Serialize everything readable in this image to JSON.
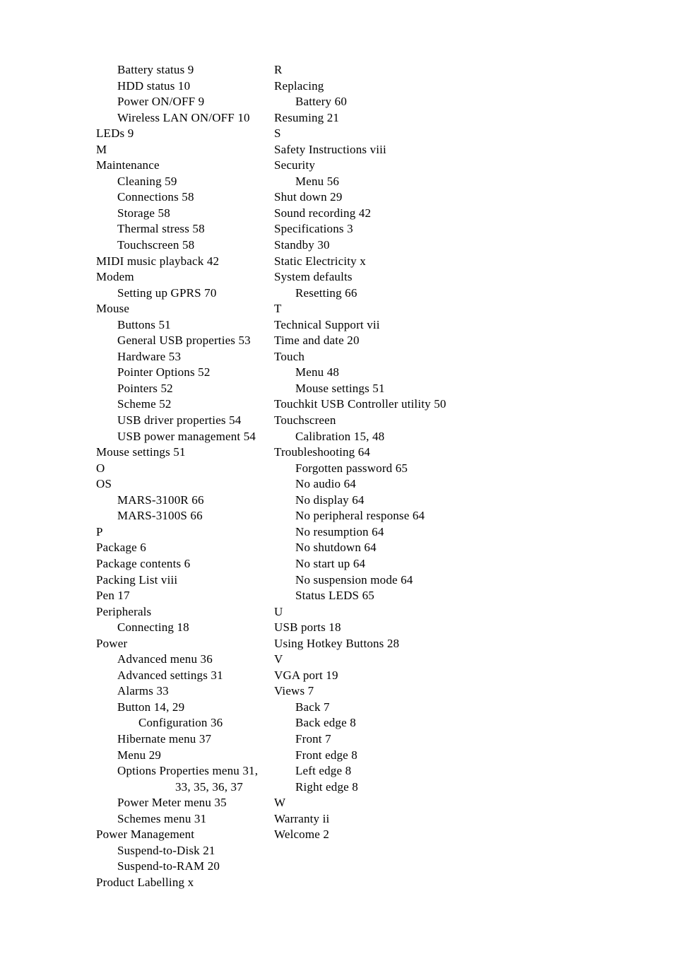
{
  "document": {
    "type": "book-index",
    "page_background": "#ffffff",
    "text_color": "#000000"
  },
  "index": {
    "columns": [
      {
        "name": "left-column",
        "entries": [
          {
            "text": "Battery status 9",
            "level": 1
          },
          {
            "text": "HDD status 10",
            "level": 1
          },
          {
            "text": "Power ON/OFF 9",
            "level": 1
          },
          {
            "text": "Wireless LAN ON/OFF 10",
            "level": 1
          },
          {
            "text": "LEDs 9",
            "level": 0
          },
          {
            "text": "M",
            "level": 0
          },
          {
            "text": "Maintenance",
            "level": 0
          },
          {
            "text": "Cleaning 59",
            "level": 1
          },
          {
            "text": "Connections 58",
            "level": 1
          },
          {
            "text": "Storage 58",
            "level": 1
          },
          {
            "text": "Thermal stress 58",
            "level": 1
          },
          {
            "text": "Touchscreen 58",
            "level": 1
          },
          {
            "text": "MIDI music playback 42",
            "level": 0
          },
          {
            "text": "Modem",
            "level": 0
          },
          {
            "text": "Setting up GPRS 70",
            "level": 1
          },
          {
            "text": "Mouse",
            "level": 0
          },
          {
            "text": "Buttons 51",
            "level": 1
          },
          {
            "text": "General USB properties 53",
            "level": 1
          },
          {
            "text": "Hardware 53",
            "level": 1
          },
          {
            "text": "Pointer Options 52",
            "level": 1
          },
          {
            "text": "Pointers 52",
            "level": 1
          },
          {
            "text": "Scheme 52",
            "level": 1
          },
          {
            "text": "USB driver properties 54",
            "level": 1
          },
          {
            "text": "USB power management 54",
            "level": 1
          },
          {
            "text": "Mouse settings 51",
            "level": 0
          },
          {
            "text": "O",
            "level": 0
          },
          {
            "text": "OS",
            "level": 0
          },
          {
            "text": "MARS-3100R 66",
            "level": 1
          },
          {
            "text": "MARS-3100S 66",
            "level": 1
          },
          {
            "text": "P",
            "level": 0
          },
          {
            "text": "Package 6",
            "level": 0
          },
          {
            "text": "Package contents 6",
            "level": 0
          },
          {
            "text": "Packing List viii",
            "level": 0
          },
          {
            "text": "Pen 17",
            "level": 0
          },
          {
            "text": "Peripherals",
            "level": 0
          },
          {
            "text": "Connecting 18",
            "level": 1
          },
          {
            "text": "Power",
            "level": 0
          },
          {
            "text": "Advanced menu 36",
            "level": 1
          },
          {
            "text": "Advanced settings 31",
            "level": 1
          },
          {
            "text": "Alarms 33",
            "level": 1
          },
          {
            "text": "Button 14, 29",
            "level": 1
          },
          {
            "text": "Configuration 36",
            "level": 2
          },
          {
            "text": "Hibernate menu 37",
            "level": 1
          },
          {
            "text": "Menu 29",
            "level": 1
          },
          {
            "text": "Options Properties menu 31, 33, 35, 36, 37",
            "level": 1,
            "wrap": true
          },
          {
            "text": "Power Meter menu 35",
            "level": 1
          },
          {
            "text": "Schemes menu 31",
            "level": 1
          },
          {
            "text": "Power Management",
            "level": 0
          },
          {
            "text": "Suspend-to-Disk 21",
            "level": 1
          },
          {
            "text": "Suspend-to-RAM 20",
            "level": 1
          },
          {
            "text": "Product Labelling x",
            "level": 0
          }
        ]
      },
      {
        "name": "right-column",
        "entries": [
          {
            "text": "R",
            "level": 0
          },
          {
            "text": "Replacing",
            "level": 0
          },
          {
            "text": "Battery 60",
            "level": 1
          },
          {
            "text": "Resuming 21",
            "level": 0
          },
          {
            "text": "S",
            "level": 0
          },
          {
            "text": "Safety Instructions viii",
            "level": 0
          },
          {
            "text": "Security",
            "level": 0
          },
          {
            "text": "Menu 56",
            "level": 1
          },
          {
            "text": "Shut down 29",
            "level": 0
          },
          {
            "text": "Sound recording 42",
            "level": 0
          },
          {
            "text": "Specifications 3",
            "level": 0
          },
          {
            "text": "Standby 30",
            "level": 0
          },
          {
            "text": "Static Electricity x",
            "level": 0
          },
          {
            "text": "System defaults",
            "level": 0
          },
          {
            "text": "Resetting 66",
            "level": 1
          },
          {
            "text": "T",
            "level": 0
          },
          {
            "text": "Technical Support vii",
            "level": 0
          },
          {
            "text": "Time and date 20",
            "level": 0
          },
          {
            "text": "Touch",
            "level": 0
          },
          {
            "text": "Menu 48",
            "level": 1
          },
          {
            "text": "Mouse settings 51",
            "level": 1
          },
          {
            "text": "Touchkit USB Controller utility 50",
            "level": 0
          },
          {
            "text": "Touchscreen",
            "level": 0
          },
          {
            "text": "Calibration 15, 48",
            "level": 1
          },
          {
            "text": "Troubleshooting 64",
            "level": 0
          },
          {
            "text": "Forgotten password 65",
            "level": 1
          },
          {
            "text": "No audio 64",
            "level": 1
          },
          {
            "text": "No display 64",
            "level": 1
          },
          {
            "text": "No peripheral response 64",
            "level": 1
          },
          {
            "text": "No resumption 64",
            "level": 1
          },
          {
            "text": "No shutdown 64",
            "level": 1
          },
          {
            "text": "No start up 64",
            "level": 1
          },
          {
            "text": "No suspension mode 64",
            "level": 1
          },
          {
            "text": "Status LEDS 65",
            "level": 1
          },
          {
            "text": "U",
            "level": 0
          },
          {
            "text": "USB ports 18",
            "level": 0
          },
          {
            "text": "Using Hotkey Buttons 28",
            "level": 0
          },
          {
            "text": "V",
            "level": 0
          },
          {
            "text": "VGA port 19",
            "level": 0
          },
          {
            "text": "Views 7",
            "level": 0
          },
          {
            "text": "Back 7",
            "level": 1
          },
          {
            "text": "Back edge 8",
            "level": 1
          },
          {
            "text": "Front 7",
            "level": 1
          },
          {
            "text": "Front edge 8",
            "level": 1
          },
          {
            "text": "Left edge 8",
            "level": 1
          },
          {
            "text": "Right edge 8",
            "level": 1
          },
          {
            "text": "W",
            "level": 0
          },
          {
            "text": "Warranty ii",
            "level": 0
          },
          {
            "text": "Welcome 2",
            "level": 0
          }
        ]
      }
    ]
  }
}
